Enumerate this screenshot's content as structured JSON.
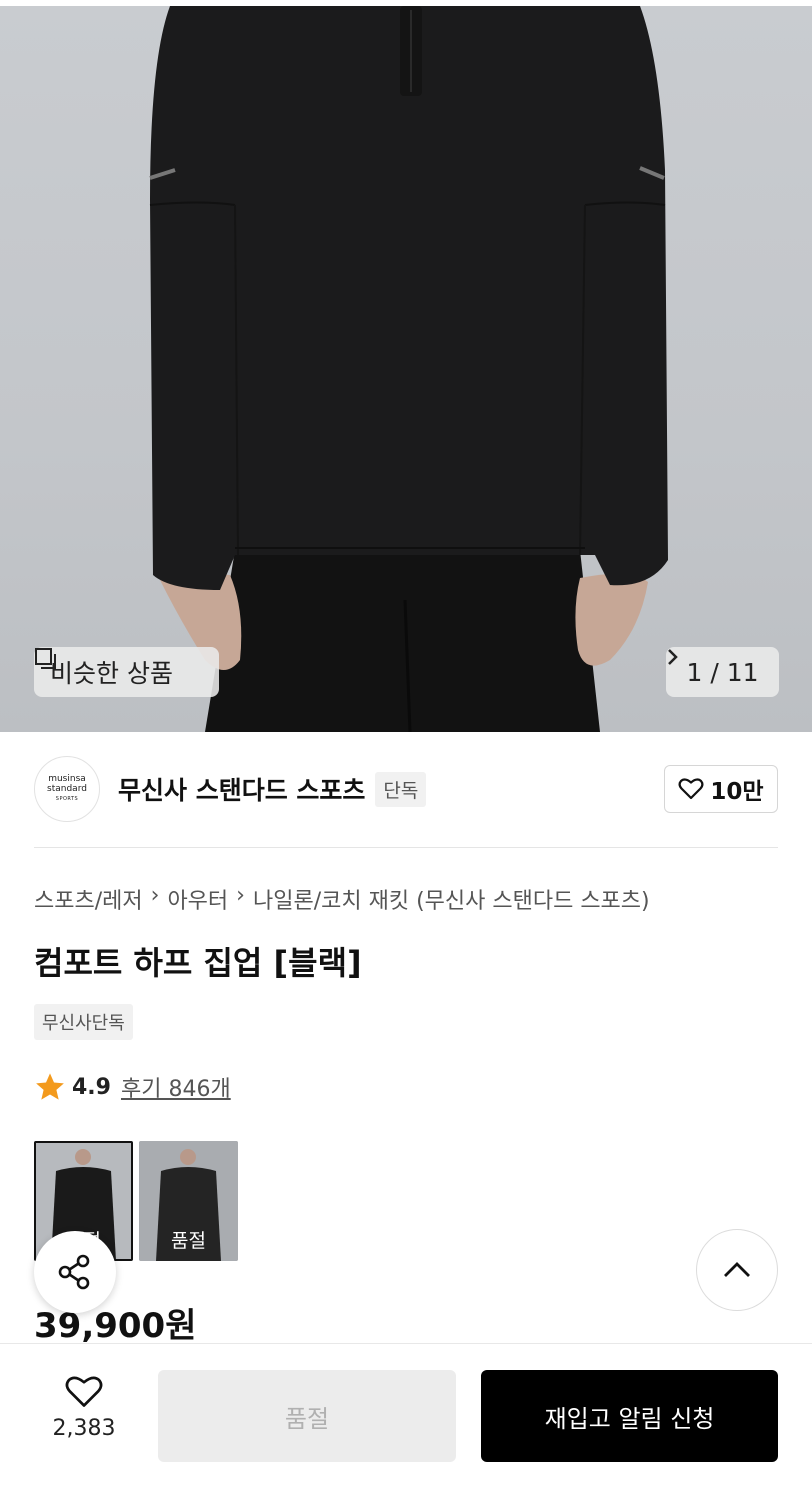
{
  "hero": {
    "similar_label": "비슷한 상품",
    "counter": "1 / 11"
  },
  "brand": {
    "logo_line1": "musinsa",
    "logo_line2": "standard",
    "logo_line3": "SPORTS",
    "name": "무신사 스탠다드 스포츠",
    "badge": "단독",
    "likes": "10만"
  },
  "breadcrumb": [
    "스포츠/레저",
    "아우터",
    "나일론/코치 재킷 (무신사 스탠다드 스포츠)"
  ],
  "product": {
    "title": "컴포트 하프 집업 [블랙]",
    "exclusive_badge": "무신사단독",
    "rating": "4.9",
    "reviews": "후기 846개",
    "thumb_soldout_1": "품절",
    "thumb_soldout_2": "품절",
    "price": "39,900원"
  },
  "bottom": {
    "wish_count": "2,383",
    "soldout_label": "품절",
    "restock_label": "재입고 알림 신청"
  },
  "colors": {
    "star": "#f39a1d",
    "primary": "#000000",
    "disabled": "#ececec"
  }
}
